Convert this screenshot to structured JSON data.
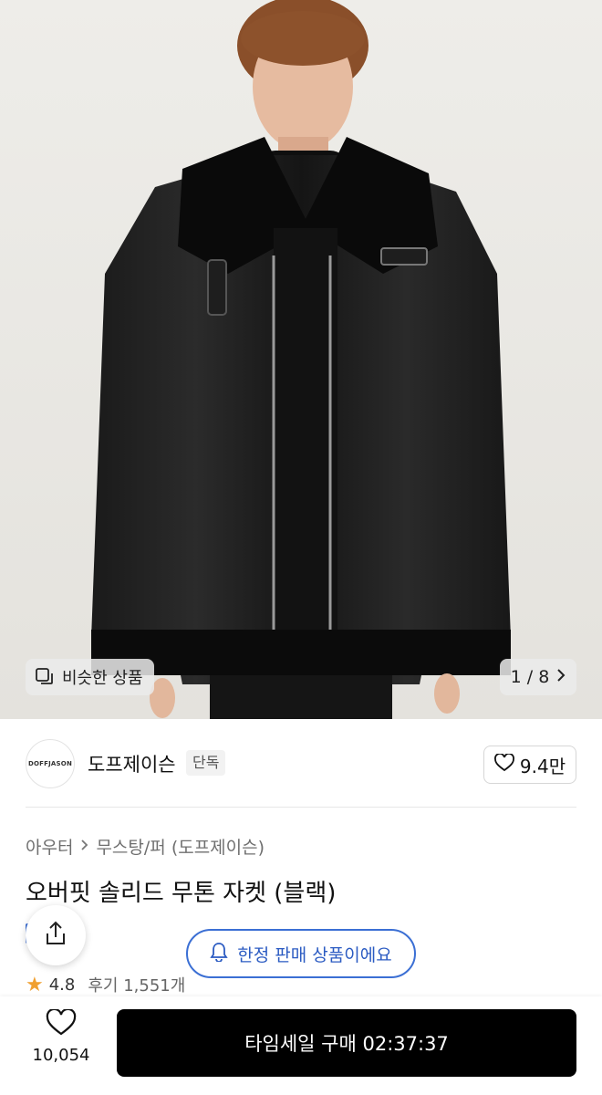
{
  "hero": {
    "similar_button_label": "비슷한 상품",
    "page_indicator": "1 / 8",
    "icons": {
      "similar": "copy-icon",
      "next": "chevron-right-icon"
    }
  },
  "brand": {
    "logo_text": "DOFFJASON",
    "name": "도프제이슨",
    "tag": "단독",
    "likes": "9.4만"
  },
  "product": {
    "breadcrumb": [
      "아우터",
      "무스탕/퍼 (도프제이슨)"
    ],
    "title": "오버핏 솔리드 무톤 자켓 (블랙)",
    "rating": "4.8",
    "reviews": "후기 1,551개"
  },
  "limited_notice": "한정 판매 상품이에요",
  "bottom": {
    "like_count": "10,054",
    "buy_label": "타임세일 구매 02:37:37"
  },
  "colors": {
    "accent_blue": "#3b6fd4",
    "star": "#f0a030",
    "buy_bg": "#000000"
  }
}
